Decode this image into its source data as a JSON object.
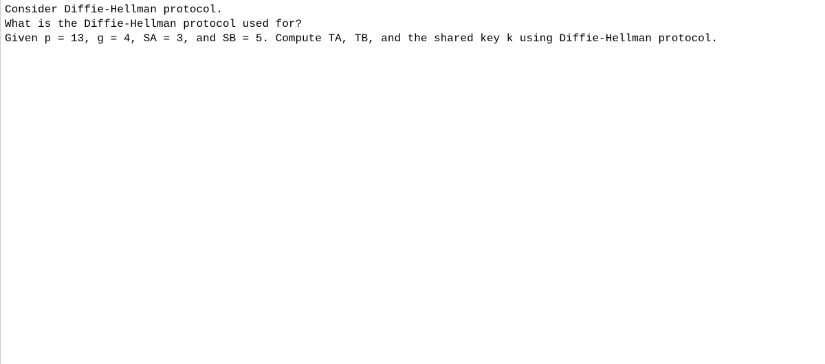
{
  "content": {
    "line1": "Consider Diffie-Hellman protocol.",
    "line2": "What is the Diffie-Hellman protocol used for?",
    "line3": "Given p = 13, g = 4, SA = 3, and SB = 5. Compute TA, TB, and the shared key k using Diffie-Hellman protocol."
  }
}
